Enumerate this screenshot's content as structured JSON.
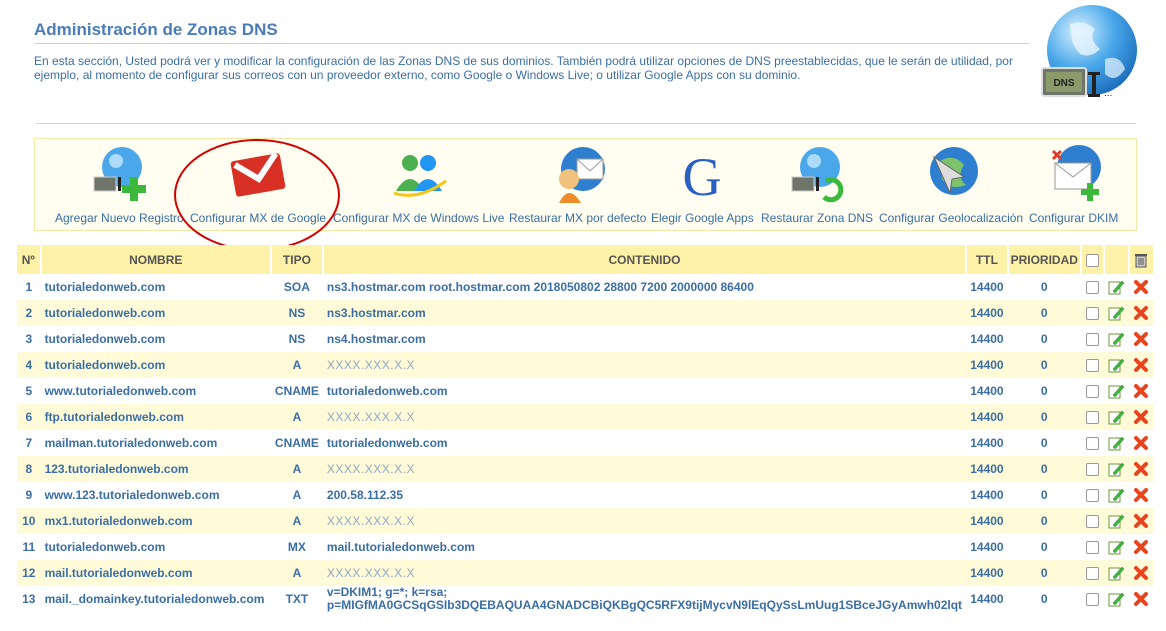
{
  "header": {
    "title": "Administración de Zonas DNS",
    "intro": "En esta sección, Usted podrá ver y modificar la configuración de las Zonas DNS de sus dominios. También podrá utilizar opciones de DNS preestablecidas, que le serán de utilidad, por ejemplo, al momento de configurar sus correos con un proveedor externo, como Google o Windows Live; o utilizar Google Apps con su dominio.",
    "logo_text": "DNS"
  },
  "toolbar": [
    {
      "label": "Agregar Nuevo Registro",
      "icon": "dns-globe-add-icon"
    },
    {
      "label": "Configurar MX de Google",
      "icon": "gmail-icon"
    },
    {
      "label": "Configurar MX de Windows Live",
      "icon": "windows-live-icon"
    },
    {
      "label": "Restaurar MX por defecto",
      "icon": "restore-mail-icon"
    },
    {
      "label": "Elegir Google Apps",
      "icon": "google-g-icon"
    },
    {
      "label": "Restaurar Zona DNS",
      "icon": "dns-globe-restore-icon"
    },
    {
      "label": "Configurar Geolocalización",
      "icon": "geolocation-globe-icon"
    },
    {
      "label": "Configurar DKIM",
      "icon": "dkim-mail-icon"
    }
  ],
  "table": {
    "headers": {
      "num": "Nº",
      "name": "NOMBRE",
      "type": "TIPO",
      "content": "CONTENIDO",
      "ttl": "TTL",
      "priority": "PRIORIDAD"
    },
    "rows": [
      {
        "n": "1",
        "name": "tutorialedonweb.com",
        "type": "SOA",
        "content": "ns3.hostmar.com root.hostmar.com 2018050802 28800 7200 2000000 86400",
        "ttl": "14400",
        "prio": "0"
      },
      {
        "n": "2",
        "name": "tutorialedonweb.com",
        "type": "NS",
        "content": "ns3.hostmar.com",
        "ttl": "14400",
        "prio": "0"
      },
      {
        "n": "3",
        "name": "tutorialedonweb.com",
        "type": "NS",
        "content": "ns4.hostmar.com",
        "ttl": "14400",
        "prio": "0"
      },
      {
        "n": "4",
        "name": "tutorialedonweb.com",
        "type": "A",
        "content": "XXXX.XXX.X.X",
        "ttl": "14400",
        "prio": "0"
      },
      {
        "n": "5",
        "name": "www.tutorialedonweb.com",
        "type": "CNAME",
        "content": "tutorialedonweb.com",
        "ttl": "14400",
        "prio": "0"
      },
      {
        "n": "6",
        "name": "ftp.tutorialedonweb.com",
        "type": "A",
        "content": "XXXX.XXX.X.X",
        "ttl": "14400",
        "prio": "0"
      },
      {
        "n": "7",
        "name": "mailman.tutorialedonweb.com",
        "type": "CNAME",
        "content": "tutorialedonweb.com",
        "ttl": "14400",
        "prio": "0"
      },
      {
        "n": "8",
        "name": "123.tutorialedonweb.com",
        "type": "A",
        "content": "XXXX.XXX.X.X",
        "ttl": "14400",
        "prio": "0"
      },
      {
        "n": "9",
        "name": "www.123.tutorialedonweb.com",
        "type": "A",
        "content": "200.58.112.35",
        "ttl": "14400",
        "prio": "0"
      },
      {
        "n": "10",
        "name": "mx1.tutorialedonweb.com",
        "type": "A",
        "content": "XXXX.XXX.X.X",
        "ttl": "14400",
        "prio": "0"
      },
      {
        "n": "11",
        "name": "tutorialedonweb.com",
        "type": "MX",
        "content": "mail.tutorialedonweb.com",
        "ttl": "14400",
        "prio": "0"
      },
      {
        "n": "12",
        "name": "mail.tutorialedonweb.com",
        "type": "A",
        "content": "XXXX.XXX.X.X",
        "ttl": "14400",
        "prio": "0"
      },
      {
        "n": "13",
        "name": "mail._domainkey.tutorialedonweb.com",
        "type": "TXT",
        "content": "v=DKIM1; g=*; k=rsa; p=MIGfMA0GCSqGSIb3DQEBAQUAA4GNADCBiQKBgQC5RFX9tijMycvN9lEqQySsLmUug1SBceJGyAmwh02lqt",
        "ttl": "14400",
        "prio": "0"
      }
    ]
  },
  "colors": {
    "accent": "#3a6ea5",
    "header_bg": "#fdf2a8",
    "alt_row": "#fffbd9",
    "highlight": "#d40000"
  }
}
